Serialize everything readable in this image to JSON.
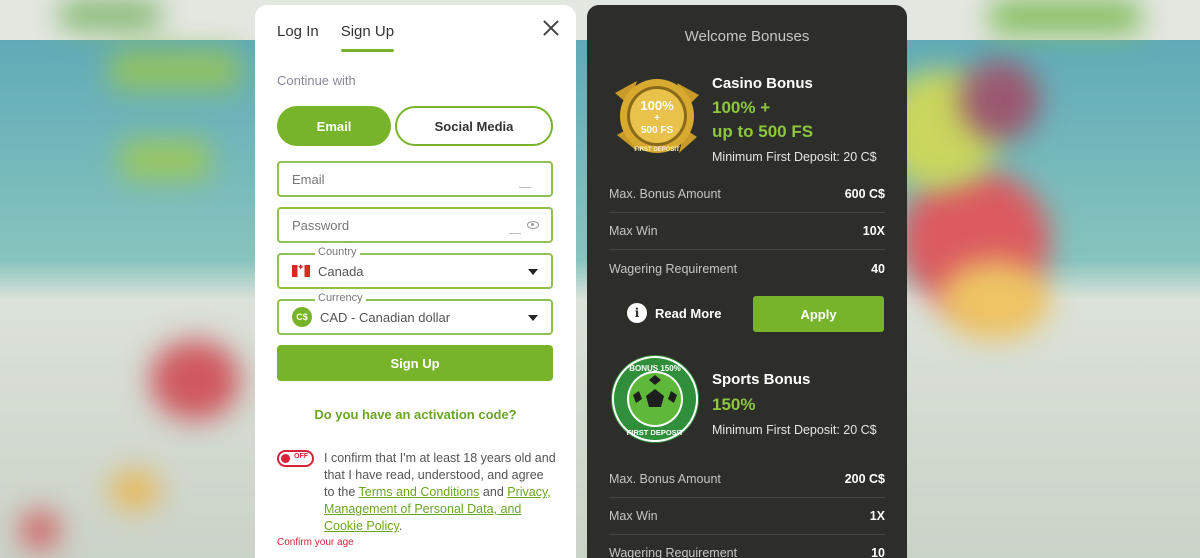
{
  "modal": {
    "tabs": [
      {
        "label": "Log In"
      },
      {
        "label": "Sign Up"
      }
    ],
    "continue_with": "Continue with",
    "method_email": "Email",
    "method_social": "Social Media",
    "email_placeholder": "Email",
    "password_placeholder": "Password",
    "country_legend": "Country",
    "country_value": "Canada",
    "currency_legend": "Currency",
    "currency_badge": "C$",
    "currency_value": "CAD - Canadian dollar",
    "signup_label": "Sign Up",
    "activation_link": "Do you have an activation code?",
    "age_switch_label": "OFF",
    "confirm_text_1": "I confirm that I'm at least 18 years old and that I have read, understood, and agree to the ",
    "terms_link": "Terms and Conditions",
    "confirm_and": " and ",
    "privacy_link": "Privacy, Management of Personal Data, and Cookie Policy",
    "confirm_end": ".",
    "error_text": "Confirm your age"
  },
  "bonuses": {
    "title": "Welcome Bonuses",
    "casino": {
      "badge_line1": "100%",
      "badge_line2": "+",
      "badge_line3": "500 FS",
      "badge_ring": "FIRST DEPOSIT",
      "name": "Casino Bonus",
      "amount_line1": "100% +",
      "amount_line2": "up to 500 FS",
      "min_deposit": "Minimum First Deposit: 20 C$",
      "rows": [
        {
          "label": "Max. Bonus Amount",
          "value": "600 C$"
        },
        {
          "label": "Max Win",
          "value": "10X"
        },
        {
          "label": "Wagering Requirement",
          "value": "40"
        }
      ],
      "read_more": "Read More",
      "apply": "Apply"
    },
    "sports": {
      "badge_top": "BONUS 150%",
      "badge_bottom": "FIRST DEPOSIT",
      "name": "Sports Bonus",
      "amount": "150%",
      "min_deposit": "Minimum First Deposit: 20 C$",
      "rows": [
        {
          "label": "Max. Bonus Amount",
          "value": "200 C$"
        },
        {
          "label": "Max Win",
          "value": "1X"
        },
        {
          "label": "Wagering Requirement",
          "value": "10"
        }
      ]
    }
  },
  "colors": {
    "accent": "#78b42a",
    "panel_bg": "#2d2e2a",
    "error": "#d6233a"
  }
}
